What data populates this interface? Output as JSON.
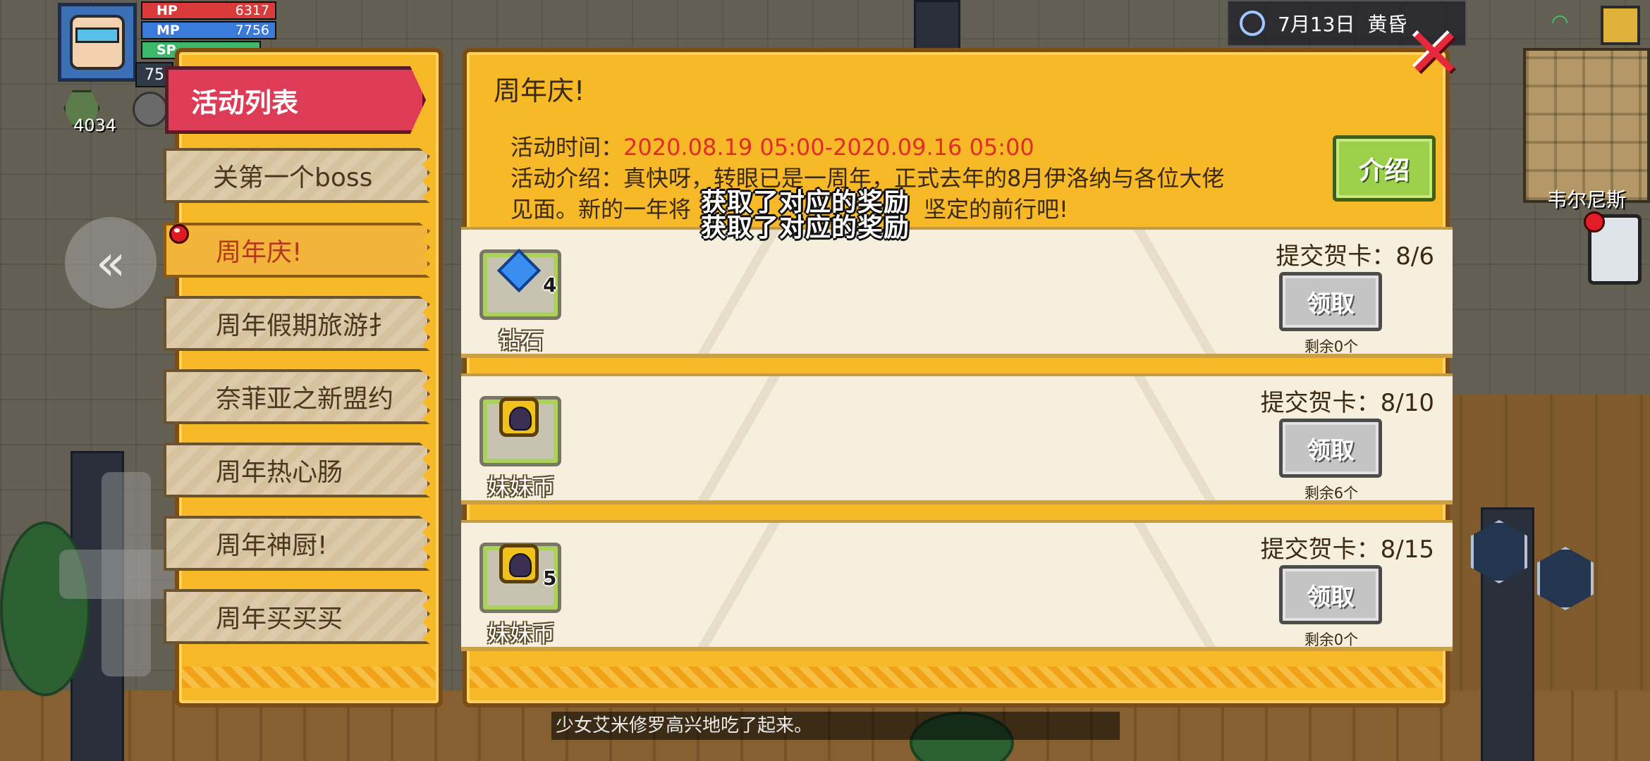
{
  "hud": {
    "level": "75",
    "hp_label": "HP",
    "hp_value": "6317",
    "hp_fraction": 1.0,
    "mp_label": "MP",
    "mp_value": "7756",
    "mp_fraction": 1.0,
    "sp_label": "SP",
    "coins": "4034",
    "date": "7月13日",
    "time_of_day": "黄昏",
    "npc_name": "韦尔尼斯",
    "chat_message": "少女艾米修罗高兴地吃了起来。",
    "colors": {
      "hp": "#d93a3a",
      "mp": "#3a7bd9",
      "sp": "#3bb86a"
    }
  },
  "menu": {
    "header": "活动列表",
    "items": [
      {
        "label": "关第一个boss",
        "active": false,
        "has_dot": false
      },
      {
        "label": "周年庆!",
        "active": true,
        "has_dot": true
      },
      {
        "label": "周年假期旅游扌",
        "active": false,
        "has_dot": false
      },
      {
        "label": "奈菲亚之新盟约",
        "active": false,
        "has_dot": false
      },
      {
        "label": "周年热心肠",
        "active": false,
        "has_dot": false
      },
      {
        "label": "周年神厨!",
        "active": false,
        "has_dot": false
      },
      {
        "label": "周年买买买",
        "active": false,
        "has_dot": false
      }
    ]
  },
  "event": {
    "title": "周年庆!",
    "time_label": "活动时间：",
    "time_value": "2020.08.19 05:00-2020.09.16 05:00",
    "desc_line1": "活动介绍：真快呀，转眼已是一周年，正式去年的8月伊洛纳与各位大佬",
    "desc_line2": "见面。新的一年将",
    "desc_line2_tail": "坚定的前行吧!",
    "intro_button": "介绍",
    "overlay_line1": "获取了对应的奖励",
    "overlay_line2": "获取了对应的奖励"
  },
  "rewards": [
    {
      "name": "钻石",
      "icon": "diamond-icon",
      "count": "4",
      "requirement": "提交贺卡：8/6",
      "button": "领取",
      "remaining": "剩余0个"
    },
    {
      "name": "妹妹币",
      "icon": "sister-coin-icon",
      "count": "",
      "requirement": "提交贺卡：8/10",
      "button": "领取",
      "remaining": "剩余6个"
    },
    {
      "name": "妹妹币",
      "icon": "sister-coin-icon",
      "count": "5",
      "requirement": "提交贺卡：8/15",
      "button": "领取",
      "remaining": "剩余0个"
    }
  ]
}
